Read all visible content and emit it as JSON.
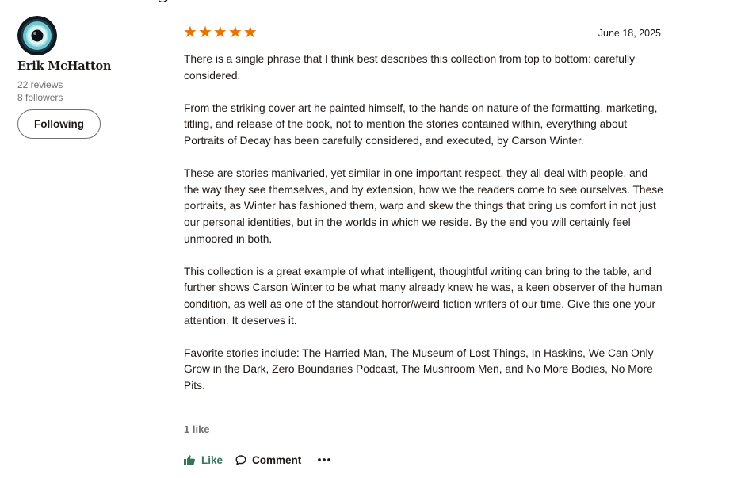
{
  "reviewer": {
    "name": "Erik McHatton",
    "reviews_count": "22 reviews",
    "followers_count": "8 followers",
    "follow_button_label": "Following"
  },
  "review": {
    "rating": 5,
    "rating_color": "#e87400",
    "date": "June 18, 2025",
    "paragraphs": [
      "There is a single phrase that I think best describes this collection from top to bottom: carefully considered.",
      "From the striking cover art he painted himself, to the hands on nature of the formatting, marketing, titling, and release of the book, not to mention the stories contained within, everything about Portraits of Decay has been carefully considered, and executed, by Carson Winter.",
      "These are stories manivaried, yet similar in one important respect, they all deal with people, and the way they see themselves, and by extension, how we the readers come to see ourselves. These portraits, as Winter has fashioned them, warp and skew the things that bring us comfort in not just our personal identities, but in the worlds in which we reside. By the end you will certainly feel unmoored in both.",
      "This collection is a great example of what intelligent, thoughtful writing can bring to the table, and further shows Carson Winter to be what many already knew he was, a keen observer of the human condition, as well as one of the standout horror/weird fiction writers of our time. Give this one your attention. It deserves it.",
      "Favorite stories include: The Harried Man, The Museum of Lost Things, In Haskins, We Can Only Grow in the Dark, Zero Boundaries Podcast, The Mushroom Men, and No More Bodies, No More Pits."
    ],
    "likes_text": "1 like"
  },
  "actions": {
    "like_label": "Like",
    "comment_label": "Comment",
    "like_color": "#377458",
    "icons": [
      "thumbs-up-icon",
      "comment-bubble-icon",
      "more-dots-icon"
    ]
  }
}
